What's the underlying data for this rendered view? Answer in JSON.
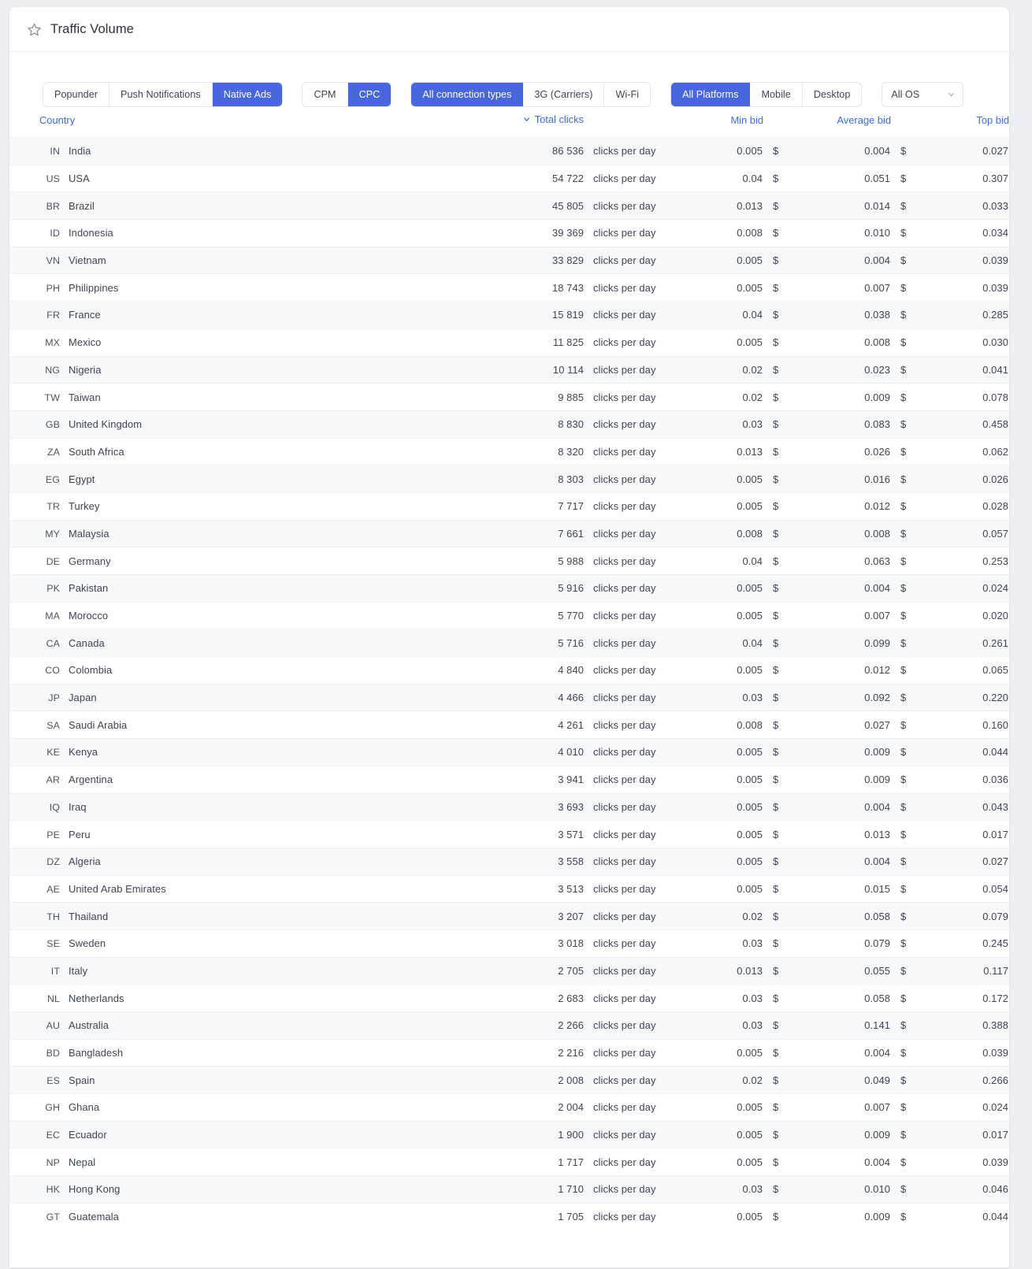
{
  "header": {
    "title": "Traffic Volume",
    "favorite_icon": "star-icon"
  },
  "filters": {
    "ad_format": {
      "options": [
        "Popunder",
        "Push Notifications",
        "Native Ads"
      ],
      "selected": "Native Ads"
    },
    "pricing_model": {
      "options": [
        "CPM",
        "CPC"
      ],
      "selected": "CPC"
    },
    "connection": {
      "options": [
        "All connection types",
        "3G (Carriers)",
        "Wi-Fi"
      ],
      "selected": "All connection types"
    },
    "platform": {
      "options": [
        "All Platforms",
        "Mobile",
        "Desktop"
      ],
      "selected": "All Platforms"
    },
    "os": {
      "selected": "All OS",
      "chevron_icon": "chevron-down-icon"
    }
  },
  "table": {
    "columns": {
      "country": "Country",
      "total_clicks": "Total clicks",
      "min_bid": "Min bid",
      "average_bid": "Average bid",
      "top_bid": "Top bid"
    },
    "sort": {
      "column": "Total clicks",
      "direction": "desc",
      "icon": "chevron-down-icon"
    },
    "clicks_unit": "clicks per day",
    "currency": "$",
    "rows": [
      {
        "code": "IN",
        "country": "India",
        "clicks": "86 536",
        "min": "0.005",
        "avg": "0.004",
        "top": "0.027"
      },
      {
        "code": "US",
        "country": "USA",
        "clicks": "54 722",
        "min": "0.04",
        "avg": "0.051",
        "top": "0.307"
      },
      {
        "code": "BR",
        "country": "Brazil",
        "clicks": "45 805",
        "min": "0.013",
        "avg": "0.014",
        "top": "0.033"
      },
      {
        "code": "ID",
        "country": "Indonesia",
        "clicks": "39 369",
        "min": "0.008",
        "avg": "0.010",
        "top": "0.034"
      },
      {
        "code": "VN",
        "country": "Vietnam",
        "clicks": "33 829",
        "min": "0.005",
        "avg": "0.004",
        "top": "0.039"
      },
      {
        "code": "PH",
        "country": "Philippines",
        "clicks": "18 743",
        "min": "0.005",
        "avg": "0.007",
        "top": "0.039"
      },
      {
        "code": "FR",
        "country": "France",
        "clicks": "15 819",
        "min": "0.04",
        "avg": "0.038",
        "top": "0.285"
      },
      {
        "code": "MX",
        "country": "Mexico",
        "clicks": "11 825",
        "min": "0.005",
        "avg": "0.008",
        "top": "0.030"
      },
      {
        "code": "NG",
        "country": "Nigeria",
        "clicks": "10 114",
        "min": "0.02",
        "avg": "0.023",
        "top": "0.041"
      },
      {
        "code": "TW",
        "country": "Taiwan",
        "clicks": "9 885",
        "min": "0.02",
        "avg": "0.009",
        "top": "0.078"
      },
      {
        "code": "GB",
        "country": "United Kingdom",
        "clicks": "8 830",
        "min": "0.03",
        "avg": "0.083",
        "top": "0.458"
      },
      {
        "code": "ZA",
        "country": "South Africa",
        "clicks": "8 320",
        "min": "0.013",
        "avg": "0.026",
        "top": "0.062"
      },
      {
        "code": "EG",
        "country": "Egypt",
        "clicks": "8 303",
        "min": "0.005",
        "avg": "0.016",
        "top": "0.026"
      },
      {
        "code": "TR",
        "country": "Turkey",
        "clicks": "7 717",
        "min": "0.005",
        "avg": "0.012",
        "top": "0.028"
      },
      {
        "code": "MY",
        "country": "Malaysia",
        "clicks": "7 661",
        "min": "0.008",
        "avg": "0.008",
        "top": "0.057"
      },
      {
        "code": "DE",
        "country": "Germany",
        "clicks": "5 988",
        "min": "0.04",
        "avg": "0.063",
        "top": "0.253"
      },
      {
        "code": "PK",
        "country": "Pakistan",
        "clicks": "5 916",
        "min": "0.005",
        "avg": "0.004",
        "top": "0.024"
      },
      {
        "code": "MA",
        "country": "Morocco",
        "clicks": "5 770",
        "min": "0.005",
        "avg": "0.007",
        "top": "0.020"
      },
      {
        "code": "CA",
        "country": "Canada",
        "clicks": "5 716",
        "min": "0.04",
        "avg": "0.099",
        "top": "0.261"
      },
      {
        "code": "CO",
        "country": "Colombia",
        "clicks": "4 840",
        "min": "0.005",
        "avg": "0.012",
        "top": "0.065"
      },
      {
        "code": "JP",
        "country": "Japan",
        "clicks": "4 466",
        "min": "0.03",
        "avg": "0.092",
        "top": "0.220"
      },
      {
        "code": "SA",
        "country": "Saudi Arabia",
        "clicks": "4 261",
        "min": "0.008",
        "avg": "0.027",
        "top": "0.160"
      },
      {
        "code": "KE",
        "country": "Kenya",
        "clicks": "4 010",
        "min": "0.005",
        "avg": "0.009",
        "top": "0.044"
      },
      {
        "code": "AR",
        "country": "Argentina",
        "clicks": "3 941",
        "min": "0.005",
        "avg": "0.009",
        "top": "0.036"
      },
      {
        "code": "IQ",
        "country": "Iraq",
        "clicks": "3 693",
        "min": "0.005",
        "avg": "0.004",
        "top": "0.043"
      },
      {
        "code": "PE",
        "country": "Peru",
        "clicks": "3 571",
        "min": "0.005",
        "avg": "0.013",
        "top": "0.017"
      },
      {
        "code": "DZ",
        "country": "Algeria",
        "clicks": "3 558",
        "min": "0.005",
        "avg": "0.004",
        "top": "0.027"
      },
      {
        "code": "AE",
        "country": "United Arab Emirates",
        "clicks": "3 513",
        "min": "0.005",
        "avg": "0.015",
        "top": "0.054"
      },
      {
        "code": "TH",
        "country": "Thailand",
        "clicks": "3 207",
        "min": "0.02",
        "avg": "0.058",
        "top": "0.079"
      },
      {
        "code": "SE",
        "country": "Sweden",
        "clicks": "3 018",
        "min": "0.03",
        "avg": "0.079",
        "top": "0.245"
      },
      {
        "code": "IT",
        "country": "Italy",
        "clicks": "2 705",
        "min": "0.013",
        "avg": "0.055",
        "top": "0.117"
      },
      {
        "code": "NL",
        "country": "Netherlands",
        "clicks": "2 683",
        "min": "0.03",
        "avg": "0.058",
        "top": "0.172"
      },
      {
        "code": "AU",
        "country": "Australia",
        "clicks": "2 266",
        "min": "0.03",
        "avg": "0.141",
        "top": "0.388"
      },
      {
        "code": "BD",
        "country": "Bangladesh",
        "clicks": "2 216",
        "min": "0.005",
        "avg": "0.004",
        "top": "0.039"
      },
      {
        "code": "ES",
        "country": "Spain",
        "clicks": "2 008",
        "min": "0.02",
        "avg": "0.049",
        "top": "0.266"
      },
      {
        "code": "GH",
        "country": "Ghana",
        "clicks": "2 004",
        "min": "0.005",
        "avg": "0.007",
        "top": "0.024"
      },
      {
        "code": "EC",
        "country": "Ecuador",
        "clicks": "1 900",
        "min": "0.005",
        "avg": "0.009",
        "top": "0.017"
      },
      {
        "code": "NP",
        "country": "Nepal",
        "clicks": "1 717",
        "min": "0.005",
        "avg": "0.004",
        "top": "0.039"
      },
      {
        "code": "HK",
        "country": "Hong Kong",
        "clicks": "1 710",
        "min": "0.03",
        "avg": "0.010",
        "top": "0.046"
      },
      {
        "code": "GT",
        "country": "Guatemala",
        "clicks": "1 705",
        "min": "0.005",
        "avg": "0.009",
        "top": "0.044"
      }
    ]
  },
  "colors": {
    "accent": "#4866dd",
    "link": "#3a6ae8",
    "page_bg": "#eceef3",
    "row_alt": "#f7f8fa"
  }
}
